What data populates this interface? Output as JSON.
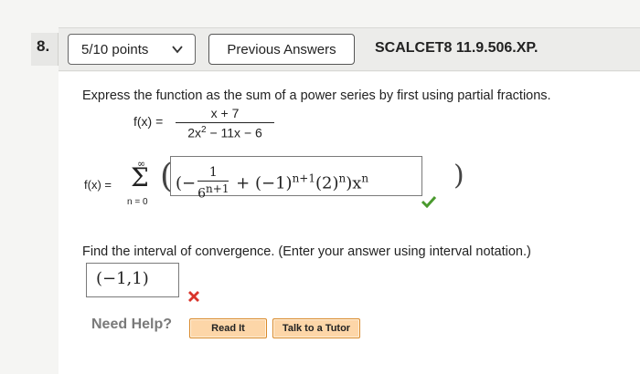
{
  "question": {
    "number": "8.",
    "points": "5/10 points",
    "previous_answers": "Previous Answers",
    "course_code": "SCALCET8 11.9.506.XP."
  },
  "problem": {
    "instruction": "Express the function as the sum of a power series by first using partial fractions.",
    "fx_label": "f(x) =",
    "numerator": "x + 7",
    "denominator_a": "2x",
    "denominator_exp": "2",
    "denominator_b": " − 11x − 6"
  },
  "series": {
    "fx_label": "f(x) =",
    "sigma": "Σ",
    "upper": "∞",
    "lower": "n = 0",
    "open_paren": "(",
    "close_paren": ")"
  },
  "answer": {
    "open": "(−",
    "frac_num": "1",
    "frac_den_base": "6",
    "frac_den_exp": "n+1",
    "mid": " + (−1)",
    "mid_exp": "n+1",
    "two": "(2)",
    "two_exp": "n",
    "close": ")x",
    "x_exp": "n",
    "status_color": "#4a9a2e"
  },
  "interval": {
    "prompt": "Find the interval of convergence. (Enter your answer using interval notation.)",
    "value": "(−1,1)",
    "status_color": "#d9342b"
  },
  "help": {
    "label": "Need Help?",
    "read_it": "Read It",
    "talk_to_tutor": "Talk to a Tutor"
  }
}
